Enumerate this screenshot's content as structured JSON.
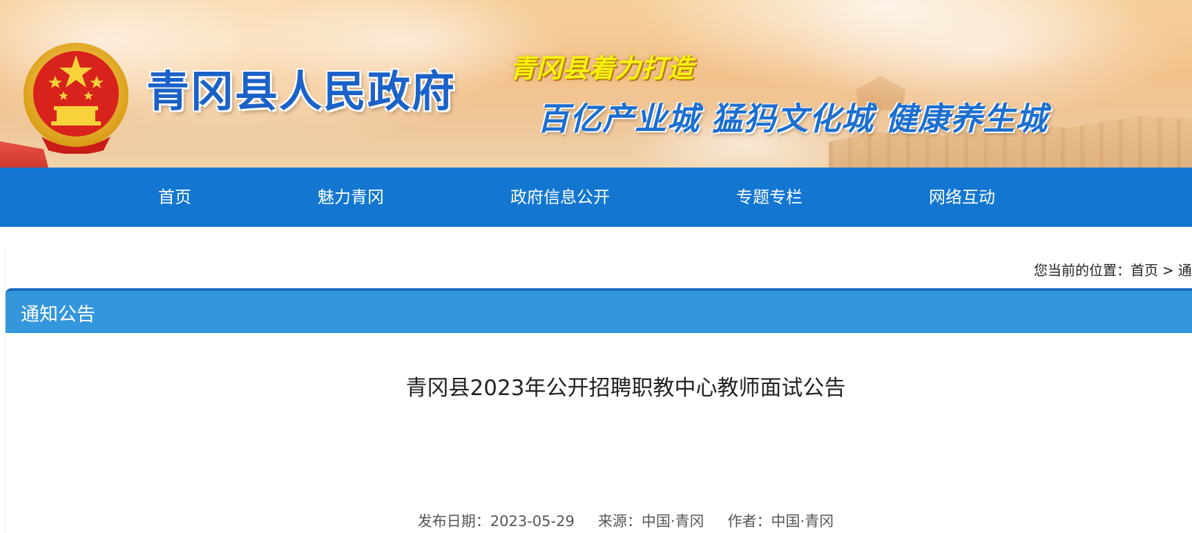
{
  "header": {
    "site_title": "青冈县人民政府",
    "slogan_line1": "青冈县着力打造",
    "slogan_line2": "百亿产业城 猛犸文化城 健康养生城",
    "emblem_icon": "national-emblem-icon"
  },
  "nav": {
    "items": [
      {
        "label": "首页"
      },
      {
        "label": "魅力青冈"
      },
      {
        "label": "政府信息公开"
      },
      {
        "label": "专题专栏"
      },
      {
        "label": "网络互动"
      }
    ],
    "background": "#1377d1"
  },
  "breadcrumb": {
    "prefix": "您当前的位置：",
    "home": "首页",
    "separator": ">",
    "current_partial": "通"
  },
  "section": {
    "title": "通知公告",
    "background": "#3496db"
  },
  "article": {
    "title": "青冈县2023年公开招聘职教中心教师面试公告",
    "meta": {
      "date": "发布日期：2023-05-29",
      "source": "来源：中国·青冈",
      "author": "作者：中国·青冈"
    }
  },
  "colors": {
    "title_blue": "#1b62c8",
    "slogan_yellow": "#f7f20f",
    "emblem_red": "#d8231c",
    "emblem_gold": "#f3c22c"
  }
}
